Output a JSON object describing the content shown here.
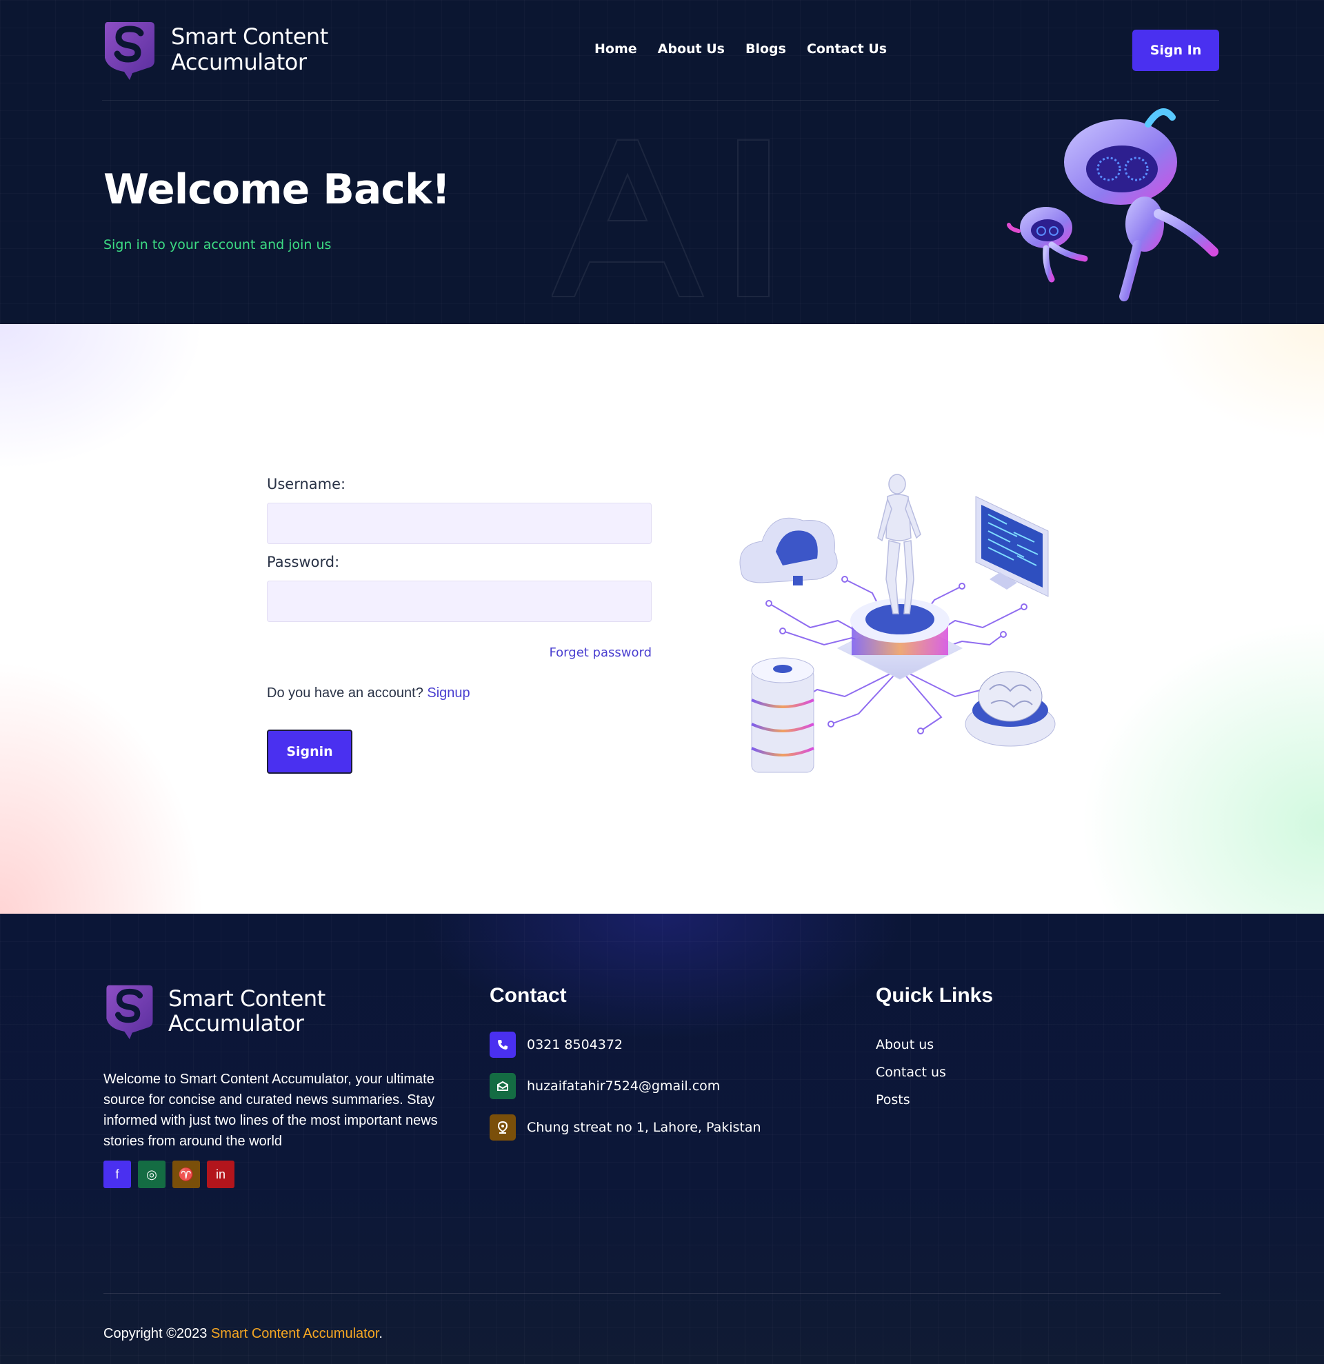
{
  "header": {
    "brand_line1": "Smart Content",
    "brand_line2": "Accumulator",
    "nav": [
      "Home",
      "About Us",
      "Blogs",
      "Contact Us"
    ],
    "signin_label": "Sign In"
  },
  "hero": {
    "title": "Welcome Back!",
    "subtitle": "Sign in to your account and join us",
    "watermark": "AI"
  },
  "form": {
    "username_label": "Username:",
    "username_value": "",
    "password_label": "Password:",
    "password_value": "",
    "forgot_label": "Forget password",
    "account_prompt": "Do you have an account?",
    "signup_label": "Signup",
    "submit_label": "Signin"
  },
  "footer": {
    "brand_line1": "Smart Content",
    "brand_line2": "Accumulator",
    "about": "Welcome to Smart Content Accumulator, your ultimate source for concise and curated news summaries. Stay informed with just two lines of the most important news stories from around the world",
    "socials": [
      {
        "name": "facebook-icon",
        "glyph": "f",
        "color": "#4a30f0"
      },
      {
        "name": "instagram-icon",
        "glyph": "◎",
        "color": "#146c43"
      },
      {
        "name": "twitter-icon",
        "glyph": "♈",
        "color": "#7a4f0a"
      },
      {
        "name": "linkedin-icon",
        "glyph": "in",
        "color": "#b3151c"
      }
    ],
    "contact_title": "Contact",
    "contacts": [
      {
        "icon": "phone-icon",
        "text": "0321 8504372",
        "color": "#4a30f0"
      },
      {
        "icon": "email-icon",
        "text": "huzaifatahir7524@gmail.com",
        "color": "#146c43"
      },
      {
        "icon": "location-icon",
        "text": "Chung streat no 1, Lahore, Pakistan",
        "color": "#7a4f0a"
      }
    ],
    "links_title": "Quick Links",
    "links": [
      "About us",
      "Contact us",
      "Posts"
    ],
    "copyright_prefix": "Copyright ©2023 ",
    "copyright_brand": "Smart Content Accumulator",
    "copyright_suffix": "."
  },
  "colors": {
    "accent": "#4a30f0",
    "hero_subtitle": "#3ddc84",
    "link": "#4a3fd0",
    "brand_highlight": "#f5a623",
    "background_dark": "#0b1631"
  }
}
